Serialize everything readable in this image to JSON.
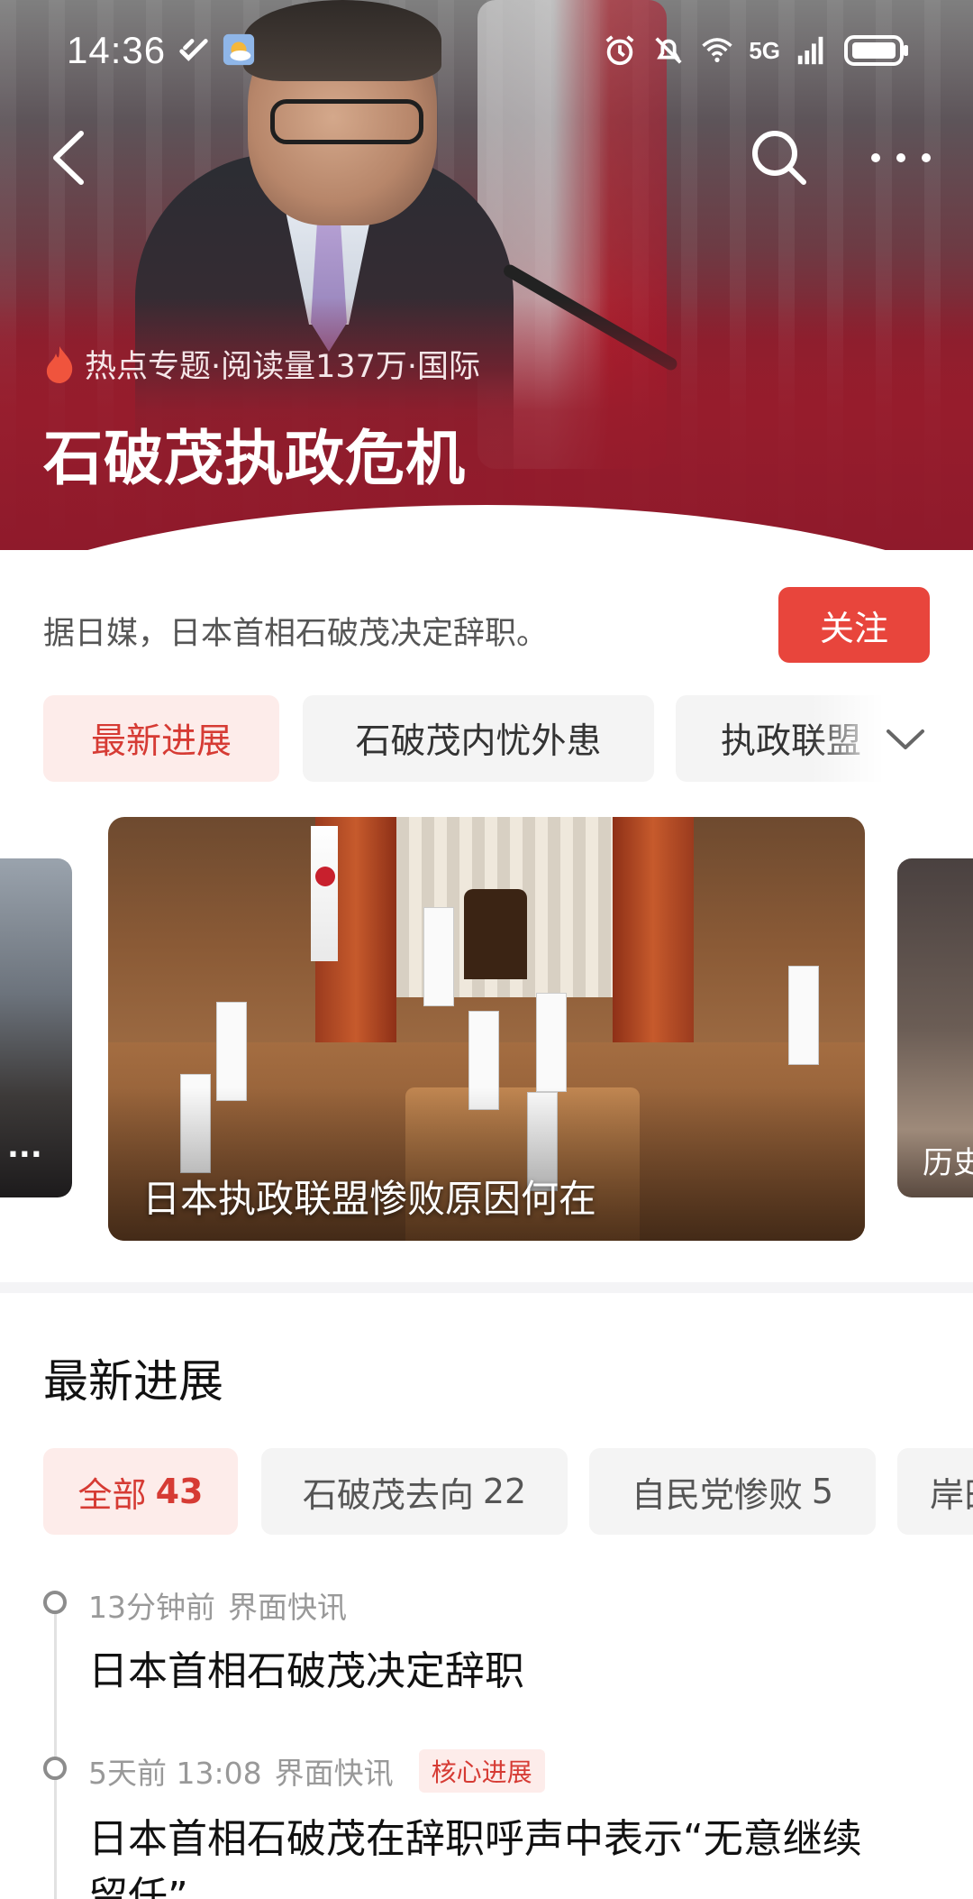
{
  "status_bar": {
    "time": "14:36",
    "network": "5G",
    "signal_slot": "6"
  },
  "nav": {
    "back_icon": "back-arrow-icon",
    "search_icon": "search-icon",
    "more_icon": "more-dots-icon"
  },
  "topic": {
    "meta": "热点专题·阅读量137万·国际",
    "title": "石破茂执政危机",
    "description": "据日媒，日本首相石破茂决定辞职。",
    "follow_label": "关注",
    "accent_color": "#e8453c",
    "hero_color": "#981d2d"
  },
  "categories": [
    {
      "label": "最新进展",
      "active": true
    },
    {
      "label": "石破茂内忧外患",
      "active": false
    },
    {
      "label": "执政联盟",
      "active": false
    }
  ],
  "carousel": {
    "left_caption": "...",
    "main_caption": "日本执政联盟惨败原因何在",
    "right_caption": "历史"
  },
  "latest": {
    "title": "最新进展",
    "filters": [
      {
        "label": "全部",
        "count": "43",
        "active": true
      },
      {
        "label": "石破茂去向",
        "count": "22",
        "active": false
      },
      {
        "label": "自民党惨败",
        "count": "5",
        "active": false
      },
      {
        "label": "岸田",
        "count": "",
        "active": false
      }
    ],
    "items": [
      {
        "time": "13分钟前",
        "source": "界面快讯",
        "badge": "",
        "headline": "日本首相石破茂决定辞职"
      },
      {
        "time": "5天前 13:08",
        "source": "界面快讯",
        "badge": "核心进展",
        "headline": "日本首相石破茂在辞职呼声中表示“无意继续留任”"
      }
    ]
  }
}
